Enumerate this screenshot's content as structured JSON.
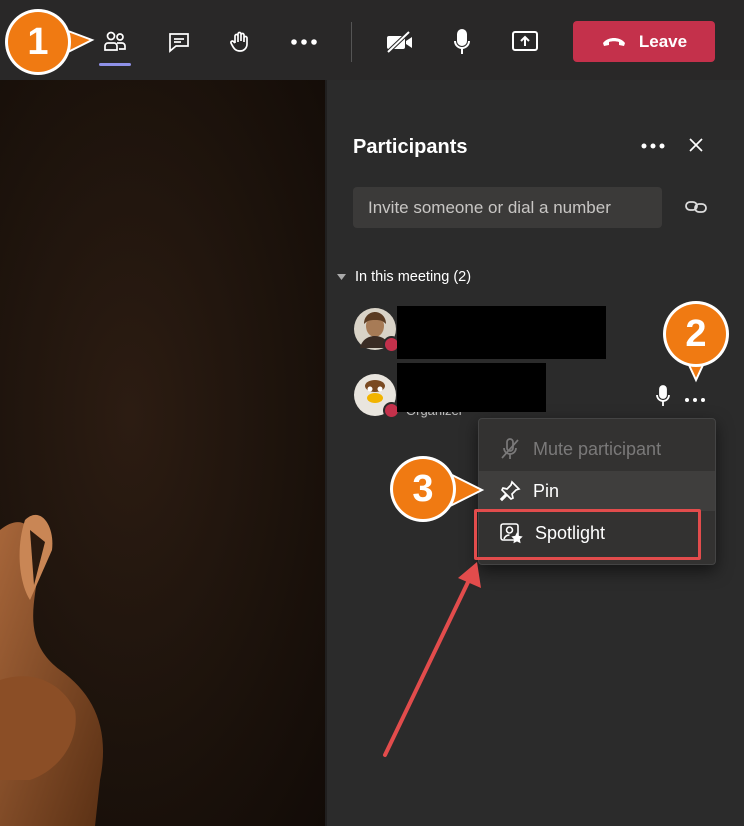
{
  "toolbar": {
    "leave_label": "Leave",
    "icons": [
      "participants-icon",
      "chat-icon",
      "raise-hand-icon",
      "more-icon",
      "camera-off-icon",
      "microphone-icon",
      "share-screen-icon",
      "hang-up-icon"
    ]
  },
  "panel": {
    "title": "Participants",
    "invite_placeholder": "Invite someone or dial a number",
    "section_label": "In this meeting (2)",
    "participants": [
      {
        "role": ""
      },
      {
        "role": "Organizer"
      }
    ]
  },
  "context_menu": {
    "items": [
      {
        "label": "Mute participant",
        "disabled": true
      },
      {
        "label": "Pin",
        "disabled": false
      },
      {
        "label": "Spotlight",
        "disabled": false
      }
    ]
  },
  "annotations": {
    "steps": [
      "1",
      "2",
      "3"
    ]
  },
  "colors": {
    "accent": "#8f91e8",
    "leave": "#c4314b",
    "callout": "#f07a12",
    "highlight": "#e24c4c"
  }
}
